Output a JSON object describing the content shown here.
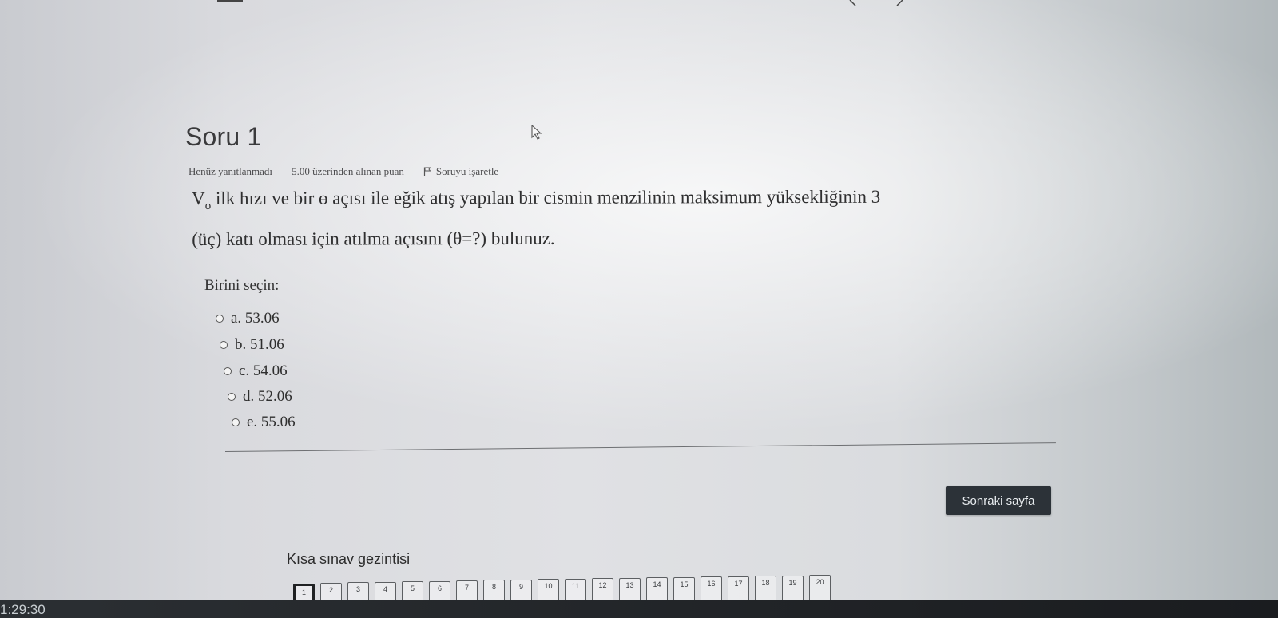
{
  "question": {
    "title": "Soru 1",
    "status": "Henüz yanıtlanmadı",
    "points": "5.00 üzerinden alınan puan",
    "flag_label": "Soruyu işaretle",
    "text_line1_prefix": "V",
    "text_line1_sub": "o",
    "text_line1_rest": " ilk hızı ve bir ɵ açısı ile eğik atış yapılan bir cismin menzilinin maksimum yüksekliğinin 3",
    "text_line2": "(üç) katı olması için atılma açısını (θ=?) bulunuz."
  },
  "answer": {
    "prompt": "Birini seçin:",
    "options": [
      {
        "label": "a. 53.06",
        "selected": false
      },
      {
        "label": "b. 51.06",
        "selected": false
      },
      {
        "label": "c. 54.06",
        "selected": false
      },
      {
        "label": "d. 52.06",
        "selected": false
      },
      {
        "label": "e. 55.06",
        "selected": false
      }
    ]
  },
  "next_button": "Sonraki sayfa",
  "quiz_nav": {
    "title": "Kısa sınav gezintisi",
    "current": 1,
    "buttons": [
      "1",
      "2",
      "3",
      "4",
      "5",
      "6",
      "7",
      "8",
      "9",
      "10",
      "11",
      "12",
      "13",
      "14",
      "15",
      "16",
      "17",
      "18",
      "19",
      "20"
    ]
  },
  "timer": "1:29:30",
  "icons": [
    "cursor-icon",
    "flag-icon"
  ],
  "colors": {
    "button_bg": "#2c3238",
    "bottom_bar": "#1f2226"
  }
}
